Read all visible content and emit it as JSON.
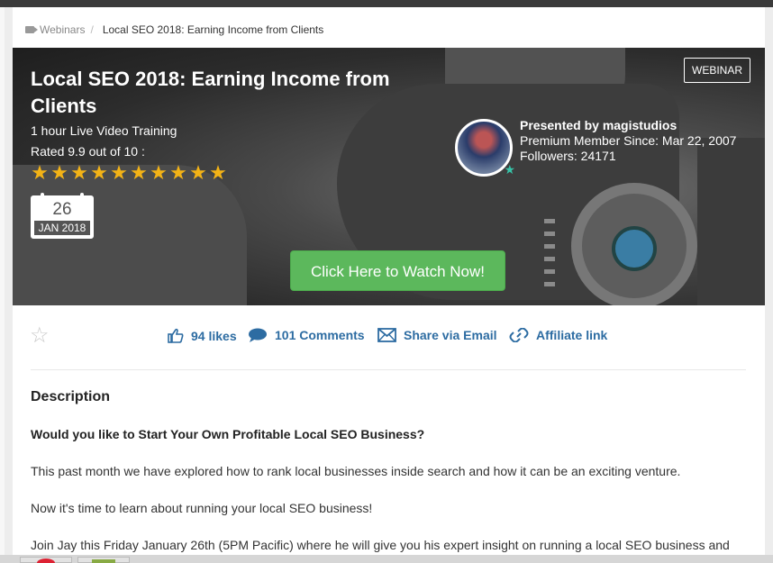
{
  "breadcrumb": {
    "section": "Webinars",
    "separator": "/",
    "current": "Local SEO 2018: Earning Income from Clients"
  },
  "hero": {
    "title": "Local SEO 2018: Earning Income from Clients",
    "subtitle": "1 hour Live Video Training",
    "rating_text": "Rated 9.9 out of 10 :",
    "rating_stars": 10,
    "date_day": "26",
    "date_month": "JAN 2018",
    "badge": "WEBINAR",
    "presenter_by": "Presented by magistudios",
    "presenter_since": "Premium Member Since: Mar 22, 2007",
    "presenter_followers": "Followers: 24171",
    "watch_button": "Click Here to Watch Now!"
  },
  "actions": {
    "likes": "94 likes",
    "comments": "101 Comments",
    "share": "Share via Email",
    "affiliate": "Affiliate link"
  },
  "description": {
    "heading": "Description",
    "question": "Would you like to Start Your Own Profitable Local SEO Business?",
    "p1": "This past month we have explored how to rank local businesses inside search and how it can be an exciting venture.",
    "p2": "Now it's time to learn about running your local SEO business!",
    "p3": "Join Jay this Friday January 26th (5PM Pacific) where he will give you his expert insight on running a local SEO business and"
  },
  "colors": {
    "accent_link": "#2d6ca2",
    "star": "#f3b316",
    "button": "#5cb85c"
  },
  "icons": {
    "breadcrumb": "video-camera-icon",
    "likes": "thumbs-up-icon",
    "comments": "speech-bubble-icon",
    "share": "envelope-icon",
    "affiliate": "link-icon",
    "favorite": "star-outline-icon"
  }
}
